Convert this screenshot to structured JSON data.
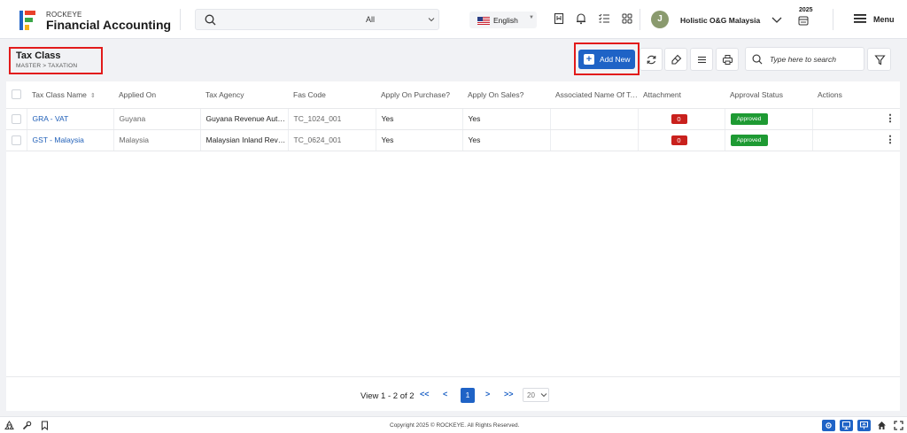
{
  "header": {
    "brand_sub": "ROCKEYE",
    "brand_main": "Financial Accounting",
    "search_scope": "All",
    "language": "English",
    "user_initial": "J",
    "company": "Holistic O&G Malaysia",
    "year": "2025",
    "menu_label": "Menu"
  },
  "page": {
    "title": "Tax Class",
    "breadcrumb": "MASTER  >  TAXATION",
    "add_new_label": "Add New",
    "search_placeholder": "Type here to search"
  },
  "table": {
    "columns": [
      "Tax Class Name",
      "Applied On",
      "Tax Agency",
      "Fas Code",
      "Apply On Purchase?",
      "Apply On Sales?",
      "Associated Name Of Tax",
      "Attachment",
      "Approval Status",
      "Actions"
    ],
    "sort_indicator": "⇕",
    "rows": [
      {
        "name": "GRA - VAT",
        "applied_on": "Guyana",
        "agency": "Guyana Revenue Authority",
        "fas_code": "TC_1024_001",
        "purchase": "Yes",
        "sales": "Yes",
        "associated": "",
        "attachment": "0",
        "status": "Approved"
      },
      {
        "name": "GST - Malaysia",
        "applied_on": "Malaysia",
        "agency": "Malaysian Inland Revenue Board",
        "fas_code": "TC_0624_001",
        "purchase": "Yes",
        "sales": "Yes",
        "associated": "",
        "attachment": "0",
        "status": "Approved"
      }
    ]
  },
  "pagination": {
    "summary": "View 1 - 2 of 2",
    "first": "<<",
    "prev": "<",
    "current_page": "1",
    "next": ">",
    "last": ">>",
    "page_size": "20"
  },
  "footer": {
    "copyright": "Copyright 2025 © ROCKEYE. All Rights Reserved."
  },
  "colors": {
    "primary": "#1f63c6",
    "approved": "#1e9a33",
    "attachment_badge": "#c9211d",
    "highlight_border": "#e21b1b"
  }
}
